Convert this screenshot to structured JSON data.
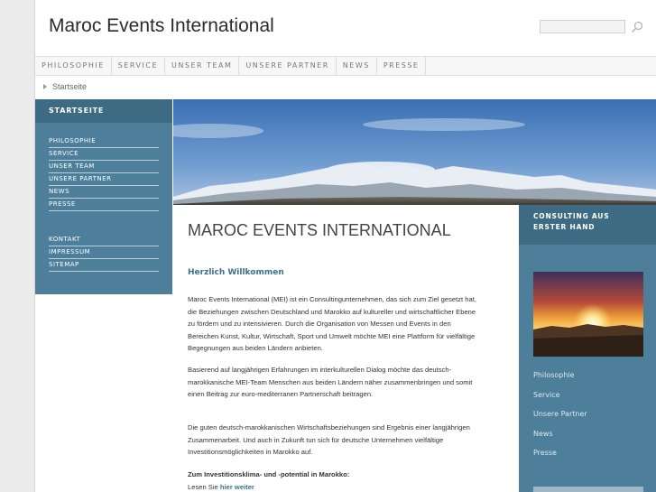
{
  "header": {
    "site_title": "Maroc Events International",
    "search_placeholder": ""
  },
  "nav": {
    "items": [
      "PHILOSOPHIE",
      "SERVICE",
      "UNSER TEAM",
      "UNSERE PARTNER",
      "NEWS",
      "PRESSE"
    ]
  },
  "breadcrumb": {
    "label": "Startseite"
  },
  "sidebar": {
    "heading": "STARTSEITE",
    "items": [
      "PHILOSOPHIE",
      "SERVICE",
      "UNSER TEAM",
      "UNSERE PARTNER",
      "NEWS",
      "PRESSE"
    ],
    "footer_items": [
      "KONTAKT",
      "IMPRESSUM",
      "SITEMAP"
    ]
  },
  "main": {
    "title": "MAROC EVENTS INTERNATIONAL",
    "subtitle": "Herzlich Willkommen",
    "para1": [
      "Maroc Events International (MEI) ist ein Consultingunternehmen, das sich zum Ziel gesetzt hat,",
      "die Beziehungen zwischen Deutschland und Marokko auf kultureller und wirtschaftlicher Ebene",
      "zu fördern und zu intensivieren. Durch die Organisation von Messen und Events in den",
      "Bereichen Kunst, Kultur, Wirtschaft, Sport und Umwelt möchte MEI eine Plattform für vielfältige",
      "Begegnungen aus beiden Ländern anbieten."
    ],
    "para2": [
      "Basierend auf langjährigen Erfahrungen im interkulturellen Dialog möchte das deutsch-",
      "marokkanische MEI-Team Menschen aus beiden Ländern näher zusammenbringen und somit",
      "einen Beitrag zur euro-mediterranen Partnerschaft beitragen."
    ],
    "para3": [
      "Die guten deutsch-marokkanischen Wirtschaftsbeziehungen sind Ergebnis einer langjährigen",
      "Zusammenarbeit. Und auch in Zukunft tun sich für deutsche Unternehmen vielfältige",
      "Investitionsmöglichkeiten in Marokko auf."
    ],
    "investment_heading": "Zum Investitionsklima- und -potential in Marokko:",
    "read_prefix": "Lesen Sie ",
    "read_link": "hier weiter"
  },
  "right": {
    "heading_line1": "CONSULTING AUS",
    "heading_line2": "ERSTER HAND",
    "links": [
      "Philosophie",
      "Service",
      "Unsere Partner",
      "News",
      "Presse"
    ]
  },
  "colors": {
    "sidebar_blue": "#4d7f9b",
    "sidebar_head": "#3e6b84",
    "heading_blue": "#3c6f8f"
  }
}
